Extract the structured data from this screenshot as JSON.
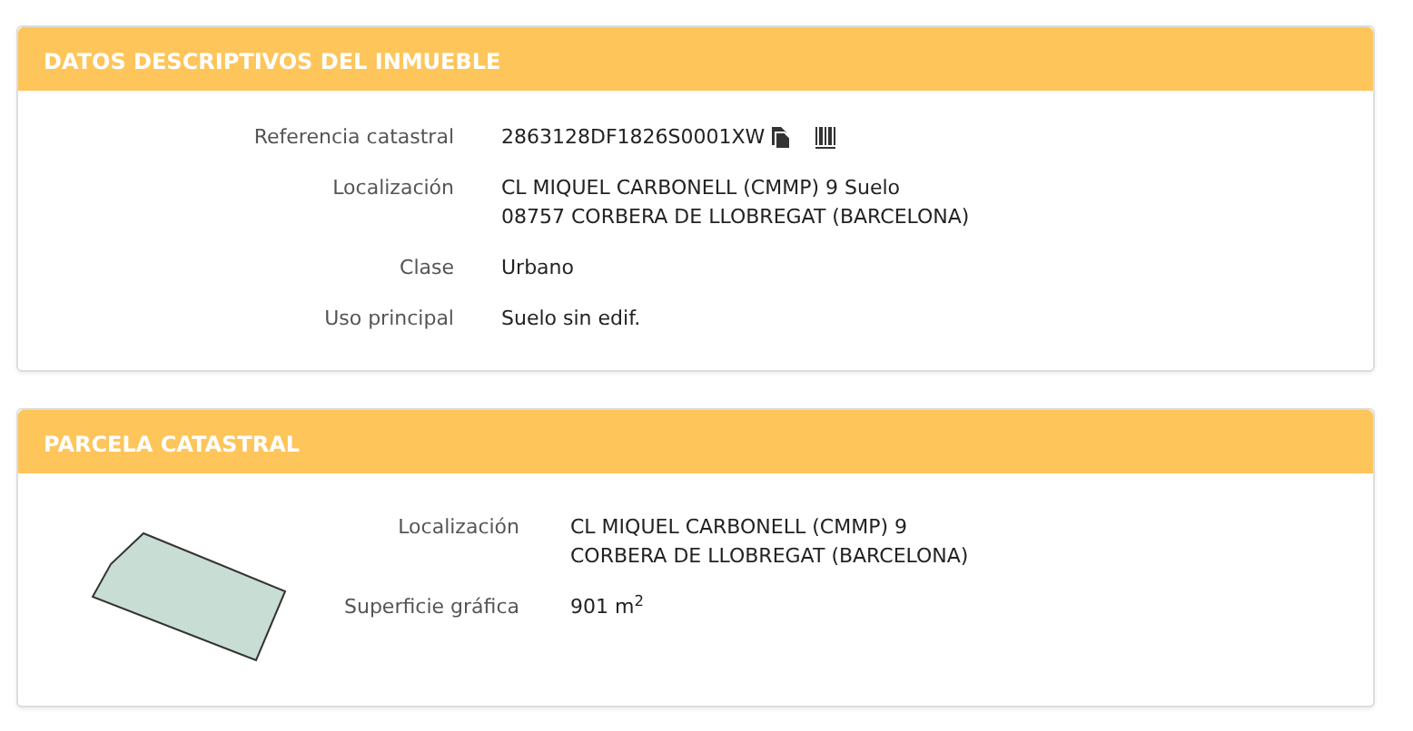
{
  "sections": [
    {
      "title": "DATOS DESCRIPTIVOS DEL INMUEBLE",
      "kind": "details",
      "fields": [
        {
          "label": "Referencia catastral",
          "lines": [
            "2863128DF1826S0001XW"
          ],
          "icons": true
        },
        {
          "label": "Localización",
          "lines": [
            "CL MIQUEL CARBONELL (CMMP) 9 Suelo",
            "08757 CORBERA DE LLOBREGAT (BARCELONA)"
          ]
        },
        {
          "label": "Clase",
          "lines": [
            "Urbano"
          ]
        },
        {
          "label": "Uso principal",
          "lines": [
            "Suelo sin edif."
          ]
        }
      ]
    },
    {
      "title": "PARCELA CATASTRAL",
      "kind": "parcel",
      "fields": [
        {
          "label": "Localización",
          "lines": [
            "CL MIQUEL CARBONELL (CMMP) 9",
            "CORBERA DE LLOBREGAT (BARCELONA)"
          ]
        },
        {
          "label": "Superficie gráfica",
          "lines": [
            "901 m$^{2}$"
          ]
        }
      ]
    }
  ]
}
